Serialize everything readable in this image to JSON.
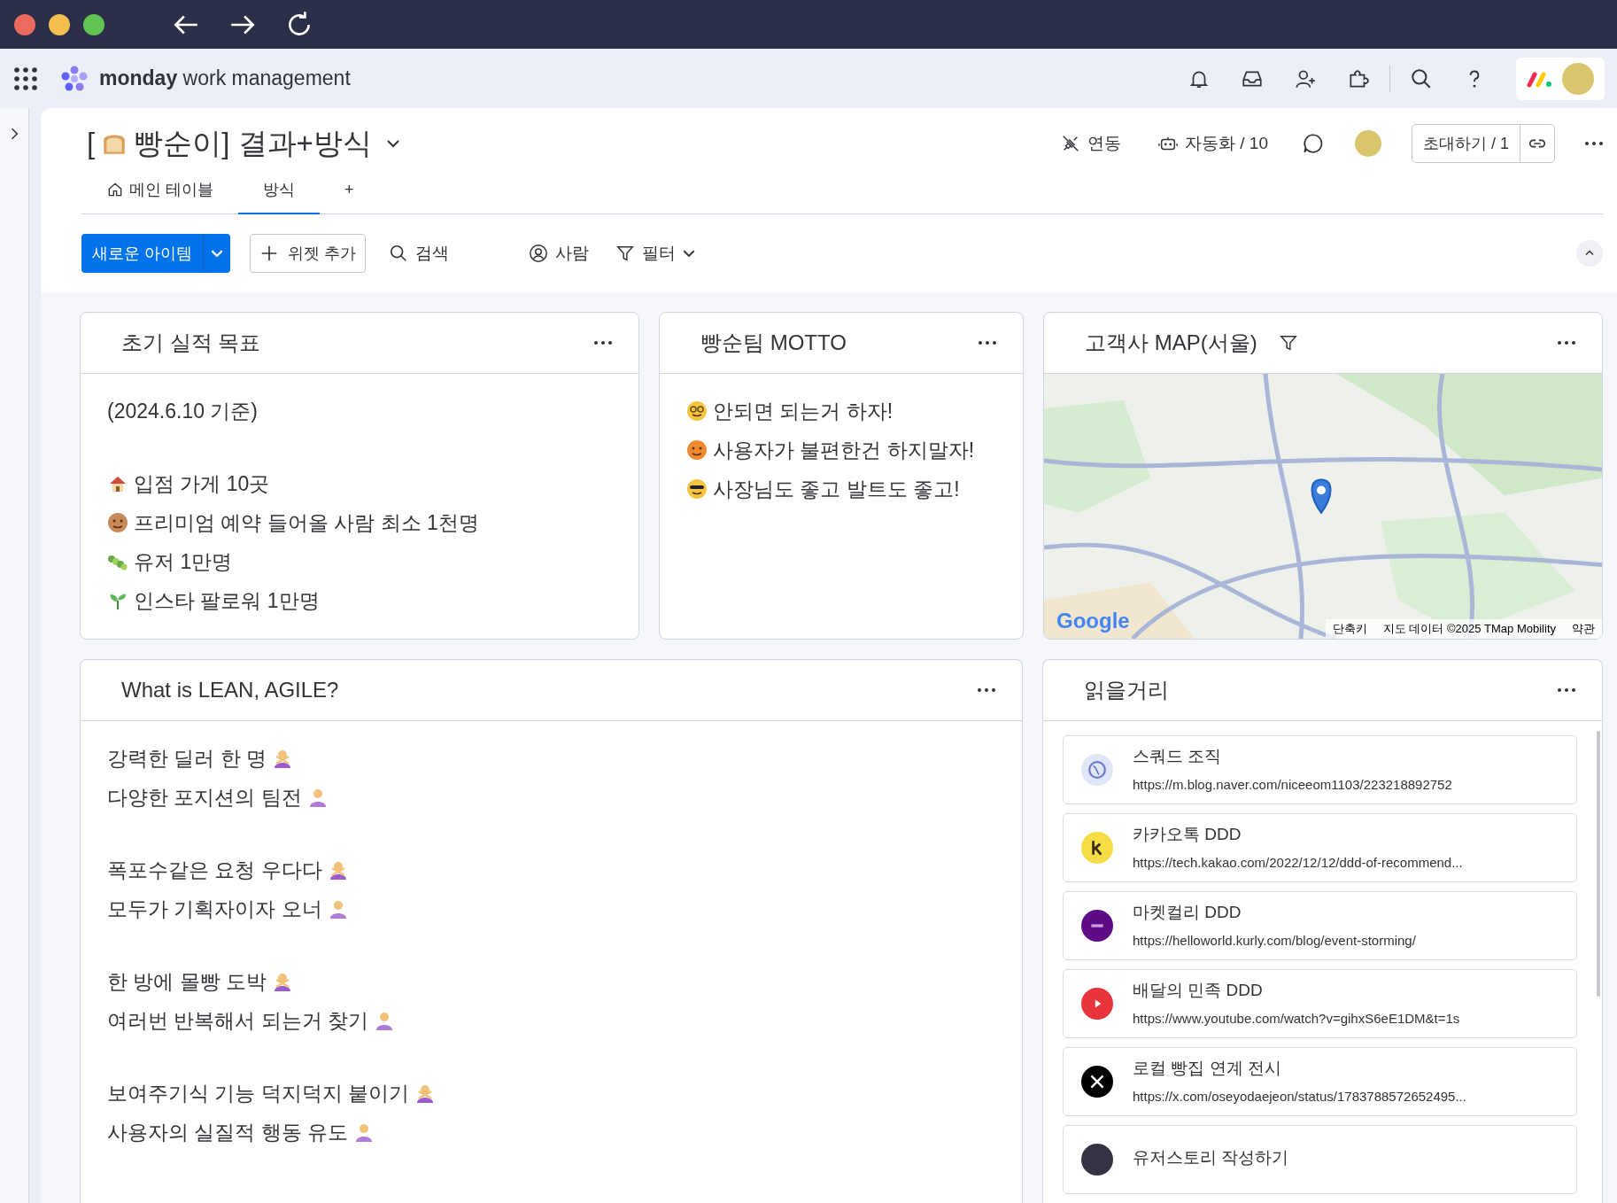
{
  "app": {
    "brand": "monday",
    "product": "work management"
  },
  "board": {
    "title_prefix": "[",
    "title": "빵순이] 결과+방식",
    "actions": [
      {
        "kind": "plug",
        "label": "연동"
      },
      {
        "kind": "robot",
        "label": "자동화 / 10"
      }
    ],
    "invite": "초대하기 / 1"
  },
  "tabs": [
    {
      "label": "메인 테이블",
      "selected": false,
      "kind": "home"
    },
    {
      "label": "방식",
      "selected": true,
      "kind": "plain"
    },
    {
      "label": "+",
      "selected": false,
      "kind": "plain"
    }
  ],
  "toolbar": {
    "new_item": "새로운 아이템",
    "add_widget": "위젯 추가",
    "search": "검색",
    "person": "사람",
    "filter": "필터"
  },
  "goals": {
    "title": "초기 실적 목표",
    "date": "(2024.6.10 기준)",
    "lines": [
      {
        "kind": "house",
        "text": "입점 가게 10곳"
      },
      {
        "kind": "monkey",
        "text": "프리미엄 예약 들어올 사람 최소 1천명"
      },
      {
        "kind": "caterpillar",
        "text": "유저 1만명"
      },
      {
        "kind": "seedling",
        "text": "인스타 팔로워 1만명"
      }
    ]
  },
  "motto": {
    "title": "빵순팀 MOTTO",
    "lines": [
      {
        "kind": "nerd",
        "text": "안되면 되는거 하자!"
      },
      {
        "kind": "angry",
        "text": "사용자가 불편한건 하지말자!"
      },
      {
        "kind": "sunglasses",
        "text": "사장님도 좋고 발트도 좋고!"
      }
    ]
  },
  "map": {
    "title": "고객사 MAP(서울)",
    "logo": "Google",
    "attribution": [
      "단축키",
      "지도 데이터 ©2025 TMap Mobility",
      "약관"
    ]
  },
  "lean": {
    "title": "What is LEAN, AGILE?",
    "paragraphs": [
      [
        {
          "kind": "gesture",
          "text": "강력한 딜러 한 명"
        },
        {
          "kind": "raising",
          "text": "다양한 포지션의 팀전"
        }
      ],
      [
        {
          "kind": "gesture",
          "text": "폭포수같은 요청 우다다"
        },
        {
          "kind": "raising",
          "text": "모두가 기획자이자 오너"
        }
      ],
      [
        {
          "kind": "gesture",
          "text": "한 방에 몰빵 도박"
        },
        {
          "kind": "raising",
          "text": "여러번 반복해서 되는거 찾기"
        }
      ],
      [
        {
          "kind": "gesture",
          "text": "보여주기식 기능 덕지덕지 붙이기"
        },
        {
          "kind": "raising",
          "text": "사용자의 실질적 행동 유도"
        }
      ]
    ]
  },
  "reading": {
    "title": "읽을거리",
    "items": [
      {
        "kind": "globe",
        "title": "스쿼드 조직",
        "url": "https://m.blog.naver.com/niceeom1103/223218892752"
      },
      {
        "kind": "kakao",
        "title": "카카오톡 DDD",
        "url": "https://tech.kakao.com/2022/12/12/ddd-of-recommend..."
      },
      {
        "kind": "kurly",
        "title": "마켓컬리 DDD",
        "url": "https://helloworld.kurly.com/blog/event-storming/"
      },
      {
        "kind": "youtube",
        "title": "배달의 민족 DDD",
        "url": "https://www.youtube.com/watch?v=gihxS6eE1DM&t=1s"
      },
      {
        "kind": "x",
        "title": "로컬 빵집 연계 전시",
        "url": "https://x.com/oseyodaejeon/status/1783788572652495..."
      },
      {
        "kind": "dark",
        "title": "유저스토리 작성하기"
      }
    ]
  }
}
